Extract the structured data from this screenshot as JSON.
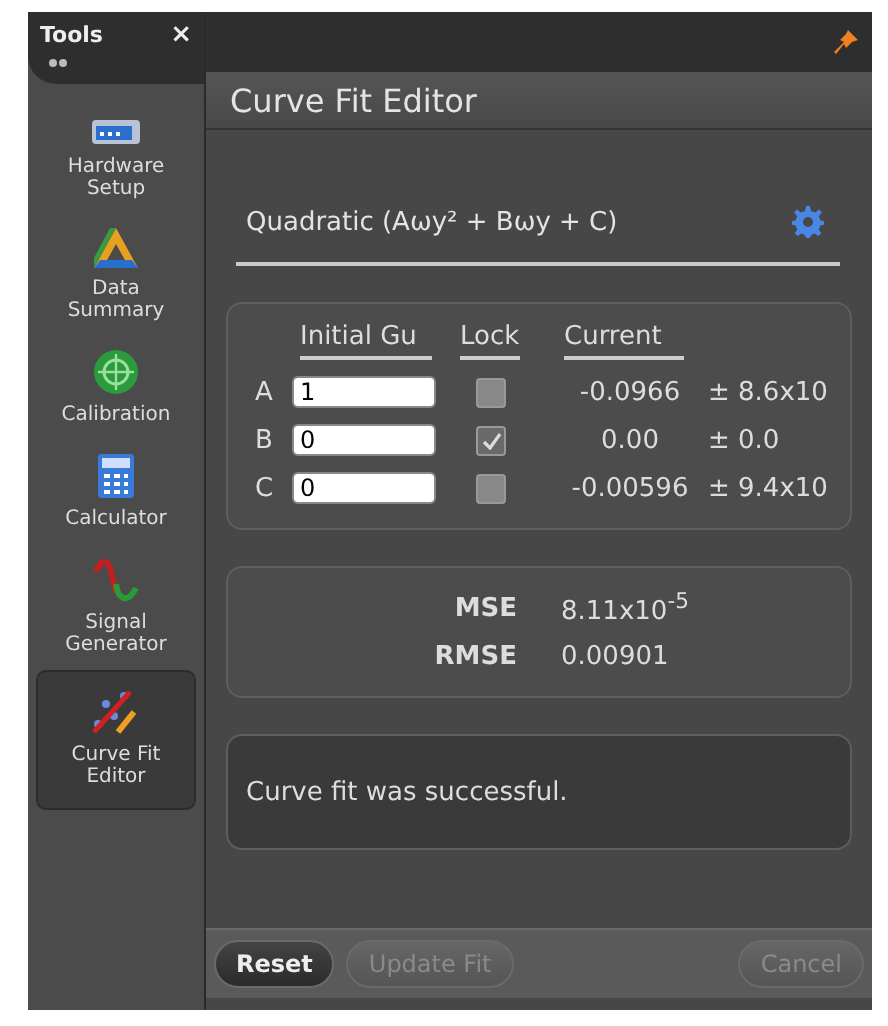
{
  "sidebar": {
    "title": "Tools",
    "close": "×",
    "items": [
      {
        "label": "Hardware Setup",
        "selected": false
      },
      {
        "label": "Data Summary",
        "selected": false
      },
      {
        "label": "Calibration",
        "selected": false
      },
      {
        "label": "Calculator",
        "selected": false
      },
      {
        "label": "Signal Generator",
        "selected": false
      },
      {
        "label": "Curve Fit Editor",
        "selected": true
      }
    ]
  },
  "panel": {
    "title": "Curve Fit Editor",
    "formula": "Quadratic (Aωy² + Bωy + C)",
    "columns": [
      "Initial Gu",
      "Lock",
      "Current"
    ],
    "parameters": [
      {
        "name": "A",
        "initial": "1",
        "locked": false,
        "current": "-0.0966",
        "error": "± 8.6x10"
      },
      {
        "name": "B",
        "initial": "0",
        "locked": true,
        "current": "0.00",
        "error": "± 0.0"
      },
      {
        "name": "C",
        "initial": "0",
        "locked": false,
        "current": "-0.00596",
        "error": "± 9.4x10"
      }
    ],
    "stats": [
      {
        "label": "MSE",
        "value": "8.11x10$^{-5}$"
      },
      {
        "label": "RMSE",
        "value": "0.00901"
      }
    ],
    "message": "Curve fit was successful.",
    "buttons": [
      {
        "label": "Reset",
        "disabled": false
      },
      {
        "label": "Update Fit",
        "disabled": true
      },
      {
        "label": "Cancel",
        "disabled": true
      }
    ]
  }
}
